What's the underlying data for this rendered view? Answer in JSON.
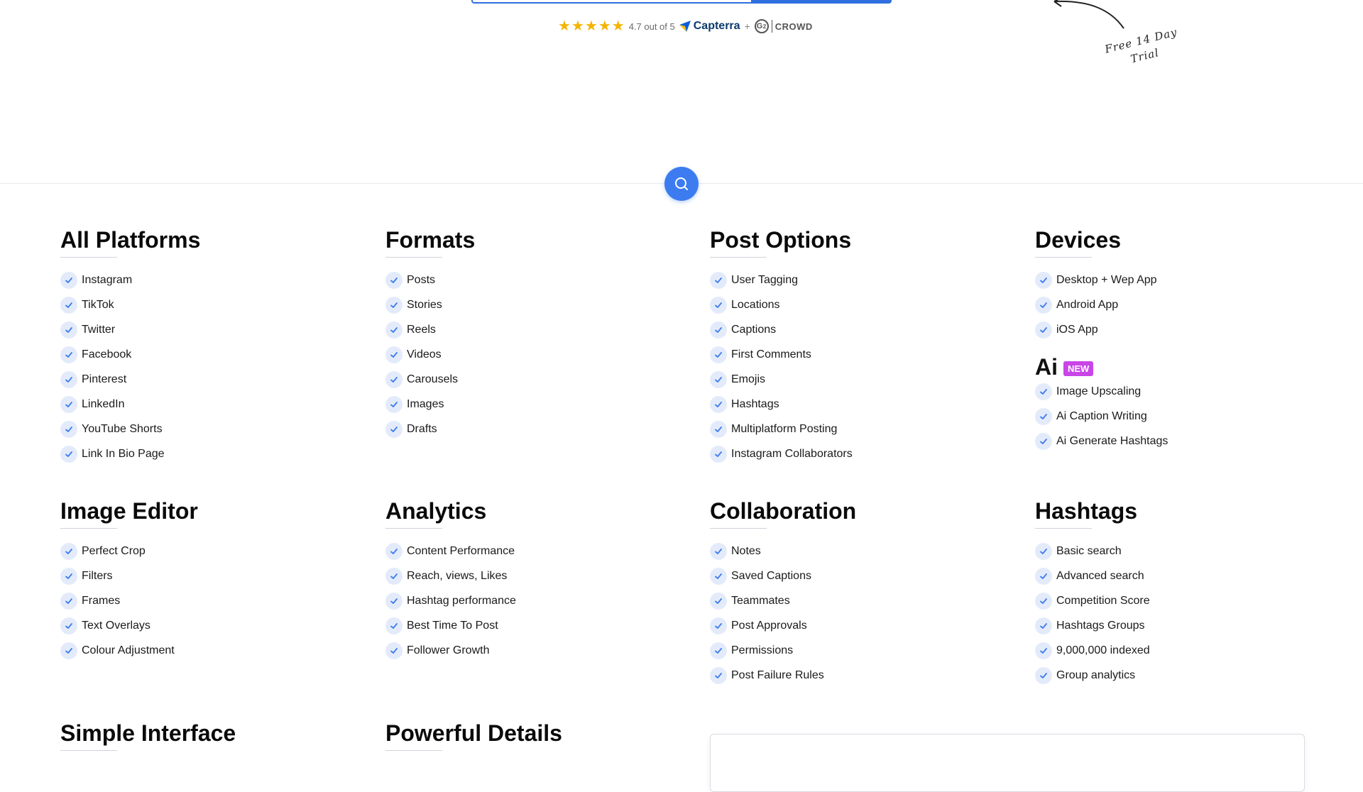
{
  "rating": {
    "stars": 5,
    "score_text": "4.7 out of 5",
    "capterra_label": "Capterra",
    "plus": "+",
    "g2_mark": "2",
    "g2_label": "CROWD"
  },
  "trial_note": {
    "line1": "Free 14 Day",
    "line2": "Trial"
  },
  "search_button": {
    "icon": "search-icon"
  },
  "sections": {
    "all_platforms": {
      "title": "All Platforms",
      "items": [
        "Instagram",
        "TikTok",
        "Twitter",
        "Facebook",
        "Pinterest",
        "LinkedIn",
        "YouTube Shorts",
        "Link In Bio Page"
      ]
    },
    "formats": {
      "title": "Formats",
      "items": [
        "Posts",
        "Stories",
        "Reels",
        "Videos",
        "Carousels",
        "Images",
        "Drafts"
      ]
    },
    "post_options": {
      "title": "Post Options",
      "items": [
        "User Tagging",
        "Locations",
        "Captions",
        "First Comments",
        "Emojis",
        "Hashtags",
        "Multiplatform Posting",
        "Instagram Collaborators"
      ]
    },
    "devices": {
      "title": "Devices",
      "items": [
        "Desktop + Wep App",
        "Android App",
        "iOS App"
      ]
    },
    "ai": {
      "title": "Ai",
      "badge": "NEW",
      "items": [
        "Image Upscaling",
        "Ai Caption Writing",
        "Ai Generate Hashtags"
      ]
    },
    "image_editor": {
      "title": "Image Editor",
      "items": [
        "Perfect Crop",
        "Filters",
        "Frames",
        "Text Overlays",
        "Colour Adjustment"
      ]
    },
    "analytics": {
      "title": "Analytics",
      "items": [
        "Content Performance",
        "Reach, views, Likes",
        "Hashtag performance",
        "Best Time To Post",
        "Follower Growth"
      ]
    },
    "collaboration": {
      "title": "Collaboration",
      "items": [
        "Notes",
        "Saved Captions",
        "Teammates",
        "Post Approvals",
        "Permissions",
        "Post Failure Rules"
      ]
    },
    "hashtags": {
      "title": "Hashtags",
      "items": [
        "Basic search",
        "Advanced search",
        "Competition Score",
        "Hashtags Groups",
        "9,000,000 indexed",
        "Group analytics"
      ]
    },
    "simple_interface": {
      "title": "Simple Interface"
    },
    "powerful_details": {
      "title": "Powerful Details"
    }
  },
  "colors": {
    "accent": "#3d7cf0",
    "check_bg": "#e3ebfb",
    "badge": "#c945e8",
    "star": "#f4b400"
  }
}
